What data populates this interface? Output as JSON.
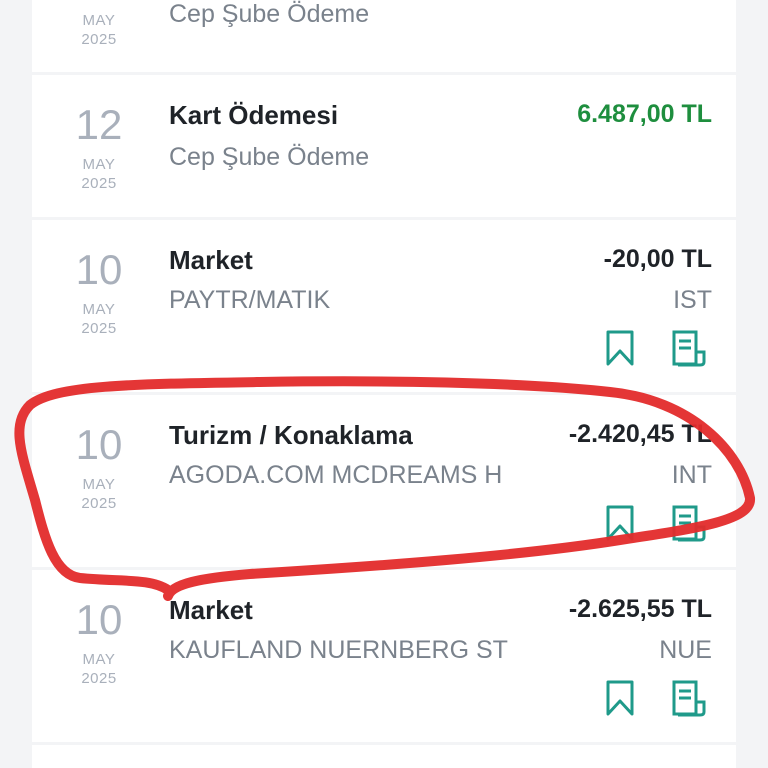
{
  "transactions": [
    {
      "day": "",
      "month": "MAY",
      "year": "2025",
      "title": "",
      "subtitle": "Cep Şube Ödeme",
      "amount": "",
      "location": ""
    },
    {
      "day": "12",
      "month": "MAY",
      "year": "2025",
      "title": "Kart Ödemesi",
      "subtitle": "Cep Şube Ödeme",
      "amount": "6.487,00 TL",
      "location": ""
    },
    {
      "day": "10",
      "month": "MAY",
      "year": "2025",
      "title": "Market",
      "subtitle": "PAYTR/MATIK",
      "amount": "-20,00 TL",
      "location": "IST"
    },
    {
      "day": "10",
      "month": "MAY",
      "year": "2025",
      "title": "Turizm / Konaklama",
      "subtitle": "AGODA.COM MCDREAMS H",
      "amount": "-2.420,45 TL",
      "location": "INT"
    },
    {
      "day": "10",
      "month": "MAY",
      "year": "2025",
      "title": "Market",
      "subtitle": "KAUFLAND NUERNBERG ST",
      "amount": "-2.625,55 TL",
      "location": "NUE"
    }
  ],
  "icons": {
    "bookmark": "bookmark-icon",
    "receipt": "receipt-icon"
  },
  "colors": {
    "positive": "#1e8e3e",
    "accent": "#1f9a8a",
    "annotation": "#e32b2b"
  }
}
